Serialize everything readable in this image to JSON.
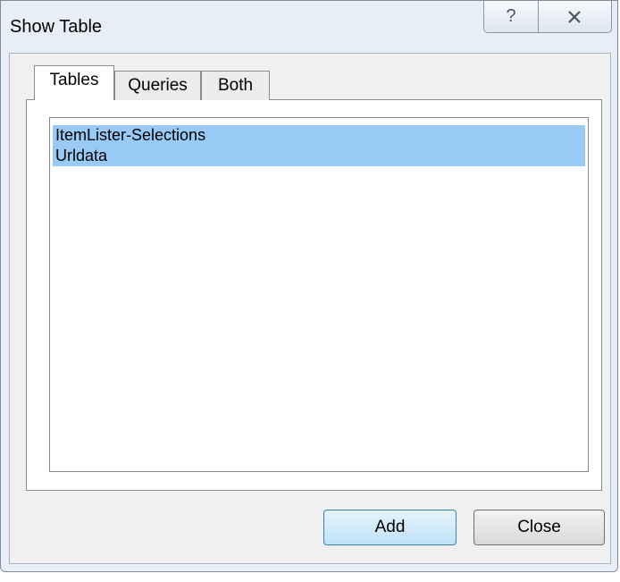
{
  "window": {
    "title": "Show Table",
    "help_glyph": "?"
  },
  "tabs": [
    {
      "label": "Tables",
      "selected": true
    },
    {
      "label": "Queries",
      "selected": false
    },
    {
      "label": "Both",
      "selected": false
    }
  ],
  "list": {
    "items": [
      {
        "label": "ItemLister-Selections",
        "selected": true
      },
      {
        "label": "Urldata",
        "selected": true
      }
    ]
  },
  "buttons": {
    "add_label": "Add",
    "close_label": "Close"
  },
  "icons": {
    "help": "help-icon",
    "close": "close-icon"
  },
  "colors": {
    "selection": "#99c9f5",
    "default_button_border": "#3c7fb1"
  }
}
